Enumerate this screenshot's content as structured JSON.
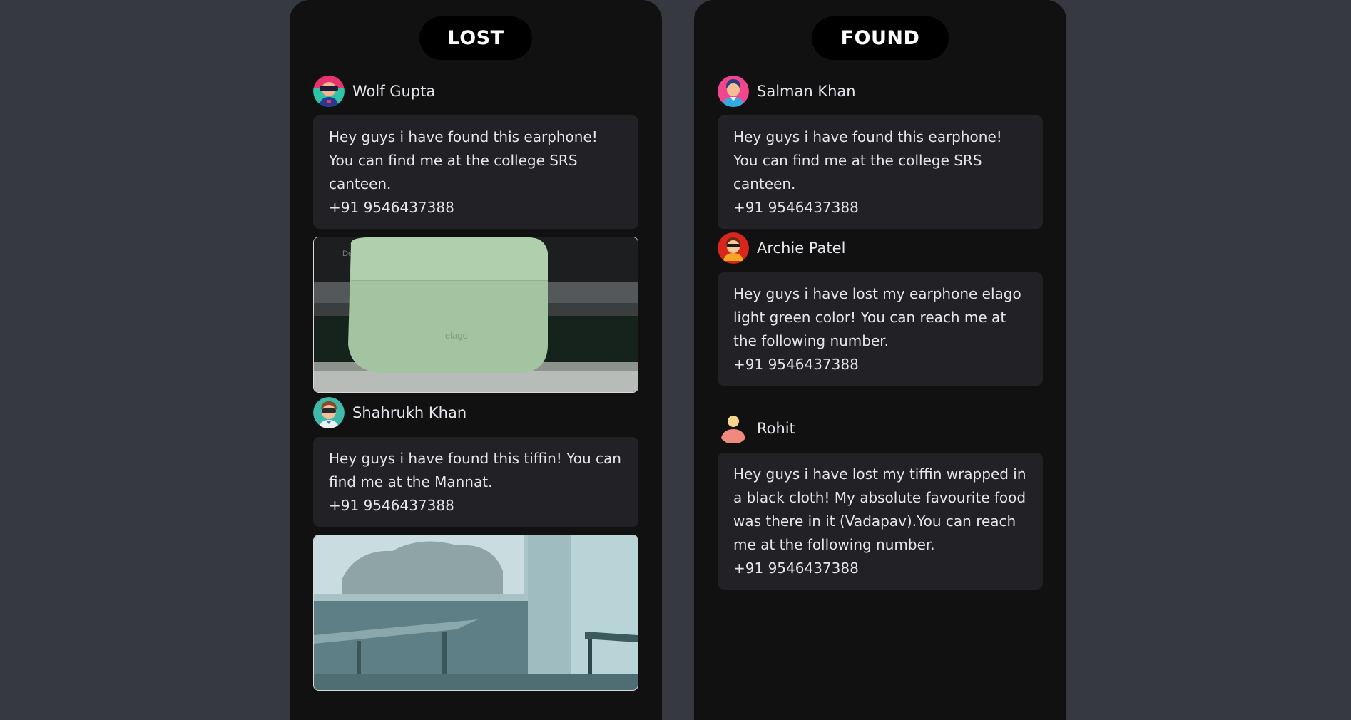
{
  "columns": {
    "lost": {
      "title": "LOST",
      "posts": [
        {
          "author": "Wolf Gupta",
          "avatar_icon": "gamer-avatar-icon",
          "message": "Hey guys i have found this earphone! You can find me at the college SRS canteen.",
          "phone": "+91 9546437388",
          "photo": "green-earphone-case-photo",
          "photo_brand_text": "elago"
        },
        {
          "author": "Shahrukh Khan",
          "avatar_icon": "vr-headset-avatar-icon",
          "message": "Hey guys i have found this tiffin! You can find me at the Mannat.",
          "phone": "+91 9546437388",
          "photo": "classroom-window-photo"
        }
      ]
    },
    "found": {
      "title": "FOUND",
      "posts": [
        {
          "author": "Salman Khan",
          "avatar_icon": "man-avatar-icon",
          "message": "Hey guys i have found this earphone! You can find me at the college SRS canteen.",
          "phone": "+91 9546437388"
        },
        {
          "author": "Archie Patel",
          "avatar_icon": "sunglasses-avatar-icon",
          "message": "Hey guys i have lost my earphone elago light green color! You can reach me at the following number.",
          "phone": "+91 9546437388"
        },
        {
          "author": "Rohit",
          "avatar_icon": "default-user-avatar-icon",
          "message": "Hey guys i have lost my tiffin wrapped in a black cloth! My absolute favourite food was there in it (Vadapav).You can reach me at the following number.",
          "phone": "+91 9546437388"
        }
      ]
    }
  },
  "colors": {
    "page_background": "#363940",
    "column_background": "#111112",
    "title_pill": "#000000",
    "bubble": "#222226",
    "text": "#e4e6eb"
  }
}
